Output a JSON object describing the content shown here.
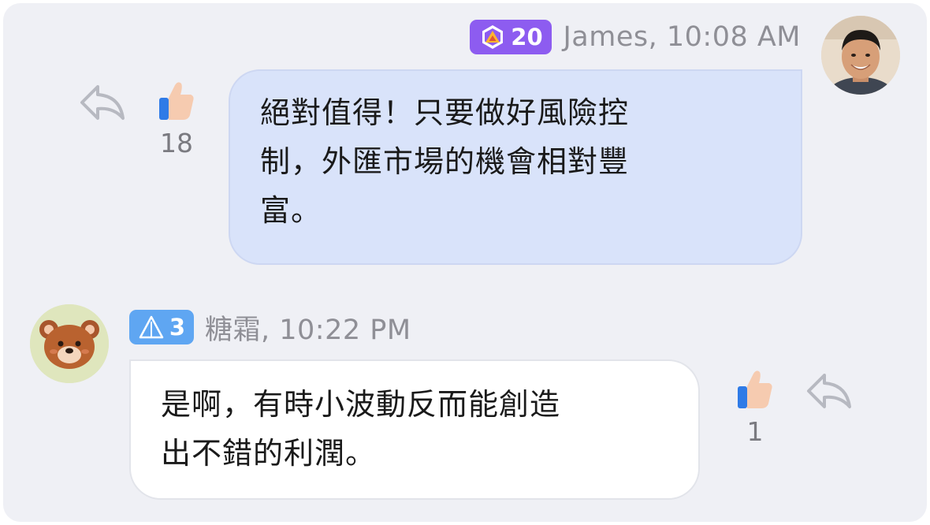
{
  "messages": [
    {
      "sender": "James, 10:08 AM",
      "badge_level": "20",
      "badge_color": "#8d5cf0",
      "text": "絕對值得！只要做好風險控制，外匯市場的機會相對豐富。",
      "line1": " 絕對值得！只要做好風險控",
      "line2": "制，外匯市場的機會相對豐",
      "line3": "富。",
      "likes": "18",
      "bubble_color": "#d9e3fa",
      "avatar": "man-photo-avatar"
    },
    {
      "sender": "糖霜, 10:22 PM",
      "badge_level": "3",
      "badge_color": "#5fa6f2",
      "text": "是啊，有時小波動反而能創造出不錯的利潤。",
      "line1": "是啊，有時小波動反而能創造",
      "line2": "出不錯的利潤。",
      "likes": "1",
      "bubble_color": "#ffffff",
      "avatar": "bear-avatar"
    }
  ],
  "icons": {
    "reply": "reply-arrow-icon",
    "like": "thumbs-up-icon",
    "badge_purple": "hexagon-triangle-icon",
    "badge_blue": "triangle-icon"
  }
}
